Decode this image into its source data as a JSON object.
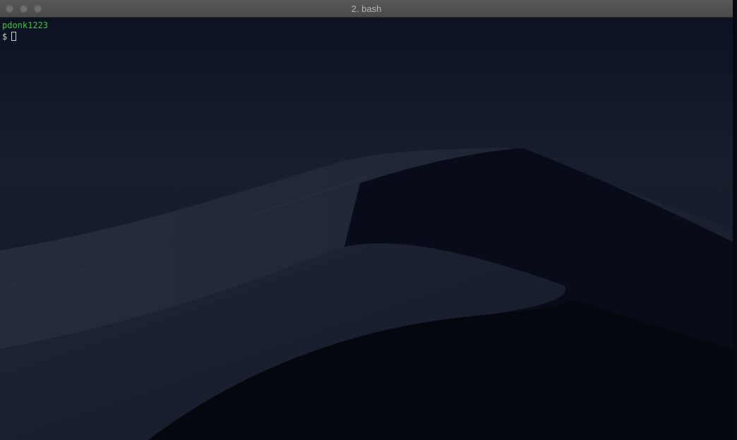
{
  "window": {
    "title": "2. bash"
  },
  "terminal": {
    "user_line": "pdonk1223",
    "prompt": "$"
  },
  "colors": {
    "titlebar": "#4f4f4f",
    "background": "#0c1020",
    "user_text": "#3fc443",
    "prompt_text": "#cfcfcf"
  }
}
